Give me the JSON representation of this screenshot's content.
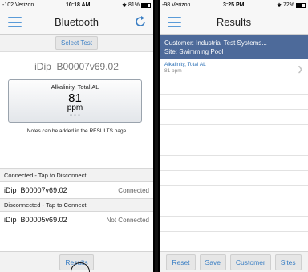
{
  "left": {
    "status": {
      "carrier": "-102 Verizon",
      "time": "10:18 AM",
      "battery": "81%",
      "battery_level": 0.81
    },
    "nav": {
      "title": "Bluetooth"
    },
    "select_test_label": "Select Test",
    "device": {
      "model": "iDip",
      "serial": "B00007v69.02"
    },
    "reading": {
      "name": "Alkalinity, Total AL",
      "value": "81",
      "unit": "ppm"
    },
    "notes": "Notes can be added in the RESULTS page",
    "connected_header": "Connected - Tap to Disconnect",
    "connected_devices": [
      {
        "model": "iDip",
        "serial": "B00007v69.02",
        "status": "Connected"
      }
    ],
    "disconnected_header": "Disconnected - Tap to Connect",
    "disconnected_devices": [
      {
        "model": "iDip",
        "serial": "B00005v69.02",
        "status": "Not Connected"
      }
    ],
    "results_button": "Results"
  },
  "right": {
    "status": {
      "carrier": "-98 Verizon",
      "time": "3:25 PM",
      "battery": "72%",
      "battery_level": 0.72
    },
    "nav": {
      "title": "Results"
    },
    "header": {
      "customer": "Customer: Industrial Test Systems...",
      "site": "Site: Swimming Pool"
    },
    "results": [
      {
        "name": "Alkalinity, Total AL",
        "value": "81 ppm"
      }
    ],
    "toolbar": {
      "reset": "Reset",
      "save": "Save",
      "customer": "Customer",
      "sites": "Sites"
    }
  },
  "colors": {
    "accent": "#3b7fc4",
    "header_blue": "#4d6a9a",
    "menu_icon": "#5a9bd8"
  }
}
